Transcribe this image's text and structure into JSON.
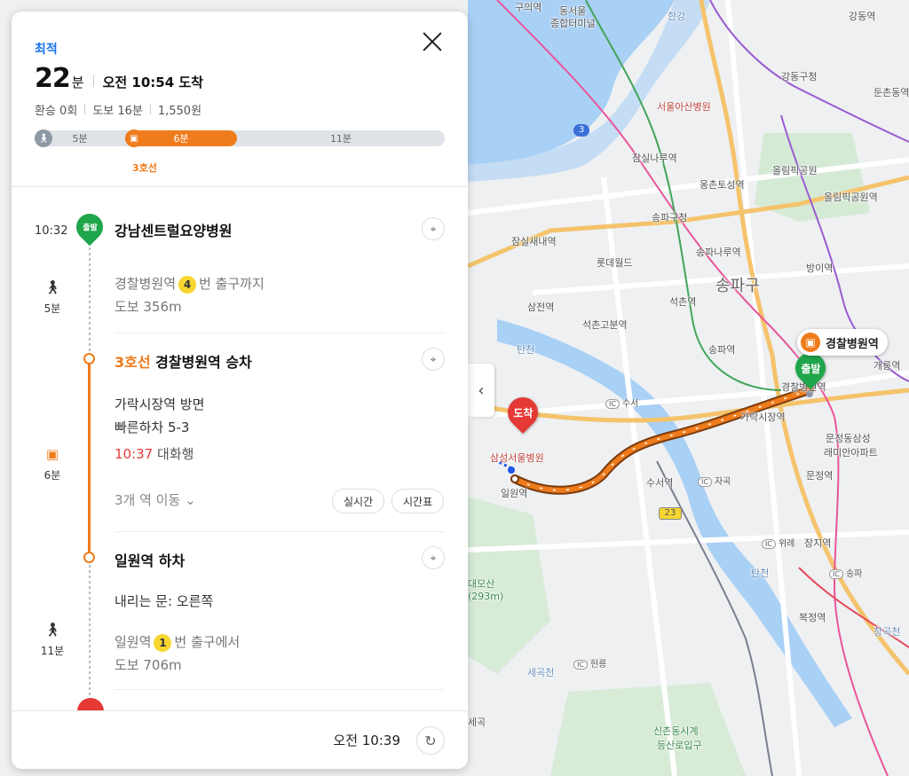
{
  "summary": {
    "best_tag": "최적",
    "duration_num": "22",
    "duration_unit": "분",
    "arrival": "오전 10:54 도착",
    "transfers": "환승 0회",
    "walk": "도보 16분",
    "fare": "1,550원",
    "segments": [
      {
        "label": "5분",
        "type": "walk"
      },
      {
        "label": "6분",
        "type": "train"
      },
      {
        "label": "11분",
        "type": "walk"
      }
    ],
    "line_tag": "3호선"
  },
  "steps": {
    "start": {
      "time": "10:32",
      "pin": "출발",
      "title": "강남센트럴요양병원"
    },
    "walk1": {
      "duration": "5분",
      "text_pre": "경찰병원역",
      "exit": "4",
      "text_post": "번 출구까지",
      "distance": "도보 356m"
    },
    "board": {
      "line": "3호선",
      "title": "경찰병원역 승차",
      "direction": "가락시장역 방면",
      "fast_exit": "빠른하차 5-3",
      "next_time": "10:37",
      "next_dest": "대화행",
      "more": "3개 역 이동",
      "realtime": "실시간",
      "timetable": "시간표",
      "duration": "6분"
    },
    "alight": {
      "title": "일원역 하차",
      "door": "내리는 문: 오른쪽"
    },
    "walk2": {
      "duration": "11분",
      "text_pre": "일원역",
      "exit": "1",
      "text_post": "번 출구에서",
      "distance": "도보 706m"
    }
  },
  "footer": {
    "now": "오전 10:39"
  },
  "map": {
    "labels": [
      {
        "t": "구의역",
        "c": ""
      },
      {
        "t": "동서울",
        "c": ""
      },
      {
        "t": "종합터미널",
        "c": ""
      },
      {
        "t": "한강",
        "c": "river"
      },
      {
        "t": "강동역",
        "c": ""
      },
      {
        "t": "강동구청",
        "c": ""
      },
      {
        "t": "둔촌동역",
        "c": ""
      },
      {
        "t": "서울아산병원",
        "c": "red"
      },
      {
        "t": "잠실나루역",
        "c": ""
      },
      {
        "t": "몽촌토성역",
        "c": ""
      },
      {
        "t": "올림픽공원",
        "c": ""
      },
      {
        "t": "올림픽공원역",
        "c": ""
      },
      {
        "t": "송파구청",
        "c": ""
      },
      {
        "t": "잠실새내역",
        "c": ""
      },
      {
        "t": "롯데월드",
        "c": ""
      },
      {
        "t": "송파나루역",
        "c": ""
      },
      {
        "t": "송파구",
        "c": "big"
      },
      {
        "t": "방이역",
        "c": ""
      },
      {
        "t": "삼전역",
        "c": ""
      },
      {
        "t": "석촌역",
        "c": ""
      },
      {
        "t": "석촌고분역",
        "c": ""
      },
      {
        "t": "탄천",
        "c": "river"
      },
      {
        "t": "송파역",
        "c": ""
      },
      {
        "t": "개롱역",
        "c": ""
      },
      {
        "t": "가락시장역",
        "c": ""
      },
      {
        "t": "문정동삼성",
        "c": ""
      },
      {
        "t": "래미안아파트",
        "c": ""
      },
      {
        "t": "삼성서울병원",
        "c": "red"
      },
      {
        "t": "일원역",
        "c": ""
      },
      {
        "t": "수서역",
        "c": ""
      },
      {
        "t": "문정역",
        "c": ""
      },
      {
        "t": "장지역",
        "c": ""
      },
      {
        "t": "대모산",
        "c": "green"
      },
      {
        "t": "(293m)",
        "c": "green"
      },
      {
        "t": "탄천",
        "c": "river"
      },
      {
        "t": "복정역",
        "c": ""
      },
      {
        "t": "창곡천",
        "c": "river"
      },
      {
        "t": "세곡천",
        "c": "river"
      },
      {
        "t": "신촌동시계",
        "c": "green"
      },
      {
        "t": "등산로입구",
        "c": "green"
      },
      {
        "t": "세곡",
        "c": ""
      },
      {
        "t": "경찰병원역",
        "c": ""
      }
    ],
    "ics": [
      "수서",
      "자곡",
      "위례",
      "송파",
      "헌릉"
    ],
    "route_badges": [
      "3",
      "23"
    ],
    "end_pin": "도착",
    "start_pin": "출발",
    "callout": "경찰병원역"
  }
}
